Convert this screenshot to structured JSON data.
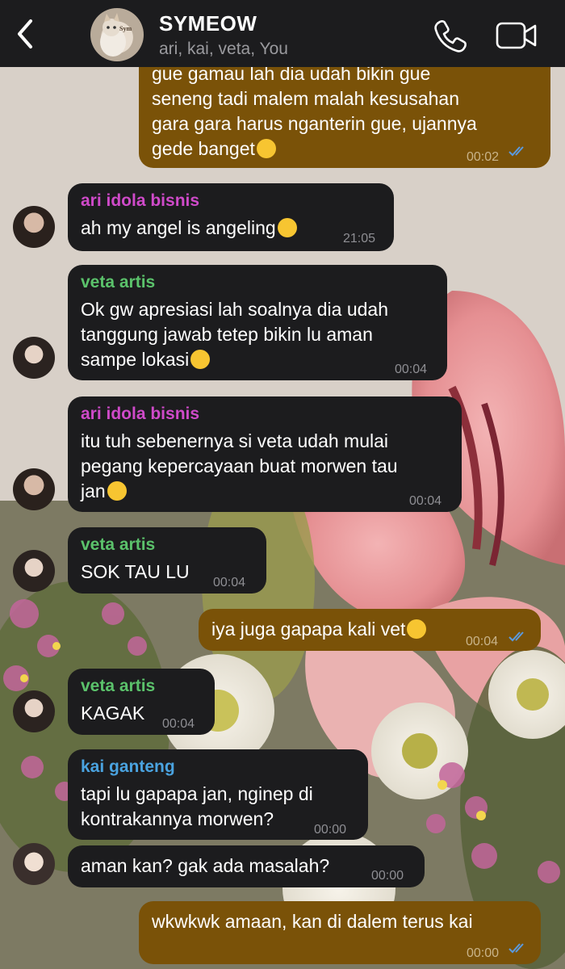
{
  "header": {
    "title": "SYMEOW",
    "subtitle": "ari, kai, veta, You",
    "avatar_text": "Symeow"
  },
  "colors": {
    "ari": "#cf4ac9",
    "veta": "#5bc26b",
    "kai": "#4aa3e0",
    "outgoing_bubble": "#7a5208",
    "incoming_bubble": "#1c1c1e",
    "read_ticks": "#5a9ae0"
  },
  "messages": [
    {
      "direction": "out",
      "lines": [
        "gue gamau lah dia udah bikin gue",
        "seneng tadi malem malah kesusahan",
        "gara gara harus nganterin gue, ujannya",
        "gede banget"
      ],
      "emoji": "frowning-face",
      "time": "00:02",
      "read": true
    },
    {
      "direction": "in",
      "sender": "ari idola bisnis",
      "lines": [
        "ah my angel is angeling"
      ],
      "emoji": "pensive-face",
      "time": "21:05"
    },
    {
      "direction": "in",
      "sender": "veta artis",
      "lines": [
        "Ok gw apresiasi lah soalnya dia udah",
        "tanggung jawab tetep bikin lu aman",
        "sampe lokasi"
      ],
      "emoji": "unamused-face",
      "time": "00:04"
    },
    {
      "direction": "in",
      "sender": "ari idola bisnis",
      "lines": [
        "itu tuh sebenernya si veta udah mulai",
        "pegang kepercayaan buat morwen tau",
        "jan"
      ],
      "emoji": "grimacing-face",
      "time": "00:04"
    },
    {
      "direction": "in",
      "sender": "veta artis",
      "lines": [
        "SOK TAU LU"
      ],
      "time": "00:04"
    },
    {
      "direction": "out",
      "lines": [
        "iya juga gapapa kali vet"
      ],
      "emoji": "rolling-on-floor-laughing",
      "time": "00:04",
      "read": true
    },
    {
      "direction": "in",
      "sender": "veta artis",
      "lines": [
        "KAGAK"
      ],
      "time": "00:04"
    },
    {
      "direction": "in",
      "sender": "kai ganteng",
      "lines": [
        "tapi lu gapapa jan, nginep di",
        "kontrakannya morwen?"
      ],
      "time": "00:00"
    },
    {
      "direction": "in",
      "lines": [
        "aman kan? gak ada masalah?"
      ],
      "time": "00:00"
    },
    {
      "direction": "out",
      "lines": [
        "wkwkwk amaan, kan di dalem terus kai"
      ],
      "time": "00:00",
      "read": true
    }
  ]
}
